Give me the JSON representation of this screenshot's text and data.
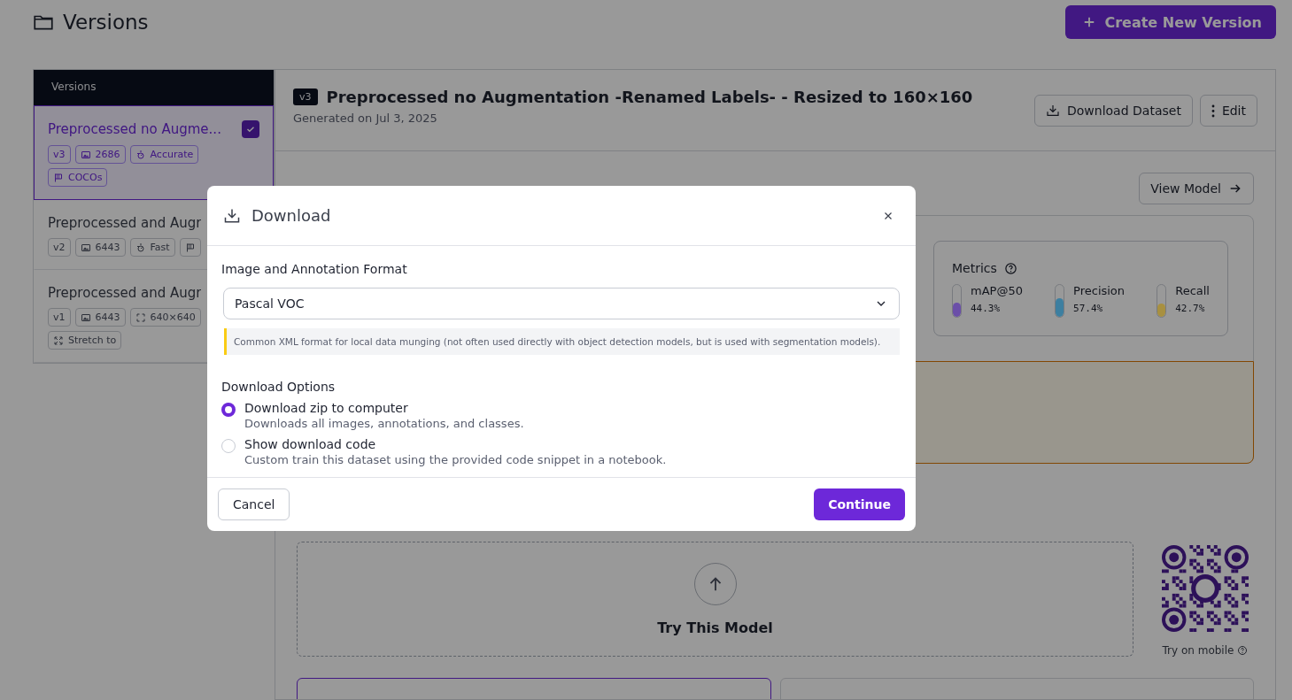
{
  "page": {
    "title": "Versions",
    "create_button": "Create New Version"
  },
  "versions_panel": {
    "header": "Versions",
    "items": [
      {
        "title": "Preprocessed no Augme...",
        "selected": true,
        "tags": [
          {
            "kind": "version",
            "text": "v3"
          },
          {
            "kind": "images",
            "text": "2686"
          },
          {
            "kind": "preset",
            "text": "Accurate"
          },
          {
            "kind": "classes",
            "text": "COCOs"
          }
        ]
      },
      {
        "title": "Preprocessed and Augr",
        "selected": false,
        "tags": [
          {
            "kind": "version",
            "text": "v2"
          },
          {
            "kind": "images",
            "text": "6443"
          },
          {
            "kind": "preset",
            "text": "Fast"
          },
          {
            "kind": "classes"
          }
        ]
      },
      {
        "title": "Preprocessed and Augr",
        "selected": false,
        "tags": [
          {
            "kind": "version",
            "text": "v1"
          },
          {
            "kind": "images",
            "text": "6443"
          },
          {
            "kind": "resize",
            "text": "640×640"
          },
          {
            "kind": "stretch",
            "text": "Stretch to"
          }
        ]
      }
    ]
  },
  "version_detail": {
    "badge": "v3",
    "title": "Preprocessed no Augmentation -Renamed Labels- - Resized to 160×160",
    "generated": "Generated on Jul 3, 2025",
    "buttons": [
      {
        "kind": "download",
        "label": "Download Dataset"
      },
      {
        "kind": "menu",
        "label": "Edit"
      }
    ],
    "model": {
      "view_button": "View Model",
      "metrics": {
        "title": "Metrics",
        "items": [
          {
            "name": "mAP@50",
            "value": "44.3%",
            "level": 0.443,
            "color": "#6b4fa8"
          },
          {
            "name": "Precision",
            "value": "57.4%",
            "level": 0.574,
            "color": "#3d7fa0"
          },
          {
            "name": "Recall",
            "value": "42.7%",
            "level": 0.427,
            "color": "#a89040"
          }
        ]
      }
    },
    "try_model": {
      "label": "Try This Model",
      "mobile": "Try on mobile"
    }
  },
  "dialog": {
    "title": "Download",
    "format_label": "Image and Annotation Format",
    "format_value": "Pascal VOC",
    "format_note": "Common XML format for local data munging (not often used directly with object detection models, but is used with segmentation models).",
    "options_label": "Download Options",
    "options": [
      {
        "title": "Download zip to computer",
        "description": "Downloads all images, annotations, and classes.",
        "selected": true
      },
      {
        "title": "Show download code",
        "description": "Custom train this dataset using the provided code snippet in a notebook.",
        "selected": false
      }
    ],
    "cancel": "Cancel",
    "continue": "Continue"
  }
}
